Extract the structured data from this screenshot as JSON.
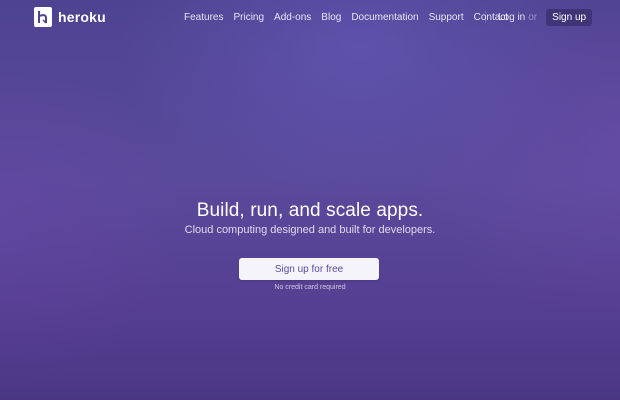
{
  "brand": {
    "name": "heroku",
    "icon": "heroku-logo-icon"
  },
  "nav": {
    "items": [
      "Features",
      "Pricing",
      "Add-ons",
      "Blog",
      "Documentation",
      "Support",
      "Contact"
    ]
  },
  "auth": {
    "login": "Log in",
    "or": "or",
    "signup": "Sign up"
  },
  "hero": {
    "title": "Build, run, and scale apps.",
    "subtitle": "Cloud computing designed and built for developers.",
    "cta": "Sign up for free",
    "note": "No credit card required"
  },
  "colors": {
    "background": "#54459a",
    "cta_bg": "#f6f4fb",
    "cta_text": "#5a4b9c"
  }
}
